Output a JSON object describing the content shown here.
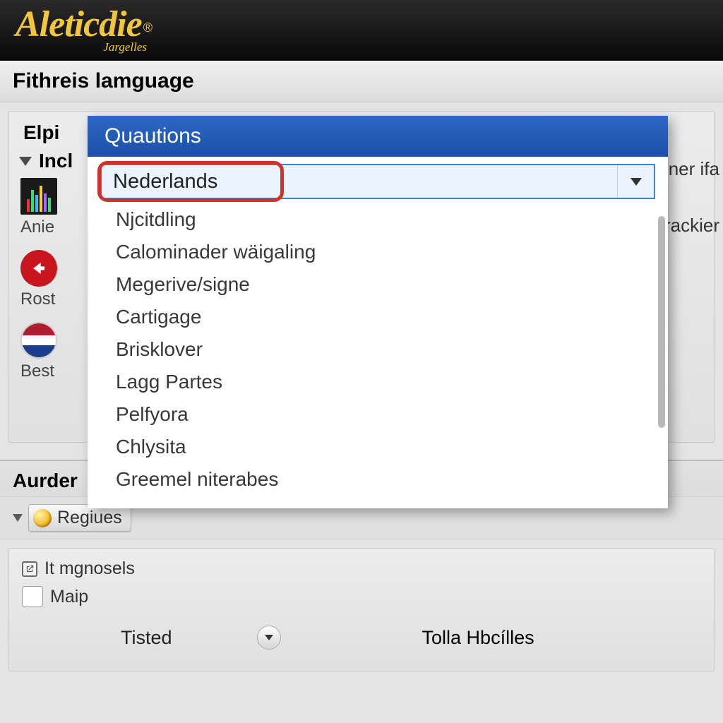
{
  "header": {
    "logo": "Aleticdie",
    "registered": "®",
    "subtitle": "Jargelles"
  },
  "page_title": "Fithreis lamguage",
  "panel1": {
    "label_top": "Elpi",
    "label_sub": "Incl",
    "apps": [
      "Anie",
      "Rost",
      "Best"
    ],
    "right1": "osner ifa",
    "right2": "Mrackier"
  },
  "dropdown": {
    "header": "Quautions",
    "selected": "Nederlands",
    "options": [
      "Njcitdling",
      "Calominader wäigaling",
      "Megerive/signe",
      "Cartigage",
      "Brisklover",
      "Lagg Partes",
      "Pelfyora",
      "Chlysita",
      "Greemel niterabes"
    ]
  },
  "section_lower": "Aurder",
  "regiues_label": "Regiues",
  "bottom": {
    "item1": "It mgnosels",
    "item2": "Maip",
    "select_left": "Tisted",
    "select_right": "Tolla Hbcílles"
  }
}
